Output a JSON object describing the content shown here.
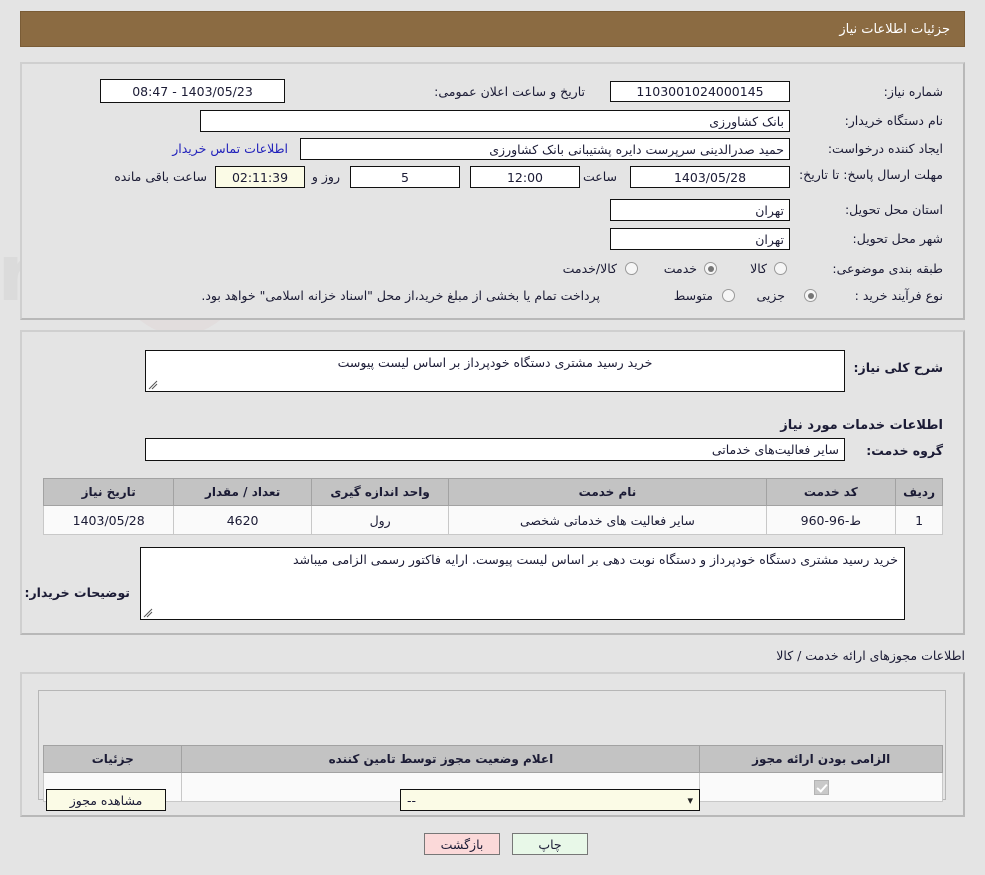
{
  "header": {
    "title": "جزئیات اطلاعات نیاز"
  },
  "details": {
    "need_number_label": "شماره نیاز:",
    "need_number_value": "1103001024000145",
    "announce_datetime_label": "تاریخ و ساعت اعلان عمومی:",
    "announce_datetime_value": "1403/05/23 - 08:47",
    "buyer_org_label": "نام دستگاه خریدار:",
    "buyer_org_value": "بانک کشاورزی",
    "creator_label": "ایجاد کننده درخواست:",
    "creator_value": "حمید صدرالدینی سرپرست دایره  پشتیبانی بانک کشاورزی",
    "contact_link": "اطلاعات تماس خریدار",
    "deadline_label": "مهلت ارسال پاسخ: تا تاریخ:",
    "deadline_date": "1403/05/28",
    "hour_label": "ساعت",
    "hour_value": "12:00",
    "days_value": "5",
    "days_unit_label": "روز و",
    "countdown_value": "02:11:39",
    "remaining_label": "ساعت باقی مانده",
    "province_label": "استان محل تحویل:",
    "province_value": "تهران",
    "city_label": "شهر محل تحویل:",
    "city_value": "تهران",
    "category_label": "طبقه بندی موضوعی:",
    "category_options": [
      {
        "label": "کالا",
        "selected": false
      },
      {
        "label": "خدمت",
        "selected": true
      },
      {
        "label": "کالا/خدمت",
        "selected": false
      }
    ],
    "process_label": "نوع فرآیند خرید :",
    "process_options": [
      {
        "label": "جزیی",
        "selected": true
      },
      {
        "label": "متوسط",
        "selected": false
      }
    ],
    "process_note": "پرداخت تمام یا بخشی از مبلغ خرید،از محل \"اسناد خزانه اسلامی\" خواهد بود."
  },
  "summary": {
    "need_desc_label": "شرح کلی نیاز:",
    "need_desc_value": "خرید رسید مشتری دستگاه خودپرداز بر اساس لیست پیوست",
    "services_section_title": "اطلاعات خدمات مورد نیاز",
    "service_group_label": "گروه خدمت:",
    "service_group_value": "سایر فعالیت‌های خدماتی"
  },
  "items_table": {
    "columns": [
      "ردیف",
      "کد خدمت",
      "نام خدمت",
      "واحد اندازه گیری",
      "تعداد / مقدار",
      "تاریخ نیاز"
    ],
    "rows": [
      {
        "row_no": "1",
        "service_code": "ط-96-960",
        "service_name": "سایر فعالیت های خدماتی شخصی",
        "unit": "رول",
        "quantity": "4620",
        "need_date": "1403/05/28"
      }
    ]
  },
  "buyer_notes": {
    "label": "توضیحات خریدار:",
    "value": "خرید رسید مشتری دستگاه خودپرداز و دستگاه نوبت دهی بر اساس لیست پیوست. ارایه فاکتور رسمی الزامی میباشد"
  },
  "permits": {
    "section_title": "اطلاعات مجوزهای ارائه خدمت / کالا",
    "columns": [
      "الزامی بودن ارائه مجوز",
      "اعلام وضعیت مجوز توسط تامین کننده",
      "جزئیات"
    ],
    "rows": [
      {
        "required_checked": true,
        "status_value": "--",
        "details_button": "مشاهده مجوز"
      }
    ]
  },
  "actions": {
    "print_label": "چاپ",
    "back_label": "بازگشت"
  },
  "colors": {
    "header_bg": "#8b6b42",
    "page_bg": "#e4e4e4",
    "link": "#2222bb",
    "print_btn": "#e8f8e8",
    "back_btn": "#fbd9d9",
    "highlight_field": "#fbfbe6"
  }
}
